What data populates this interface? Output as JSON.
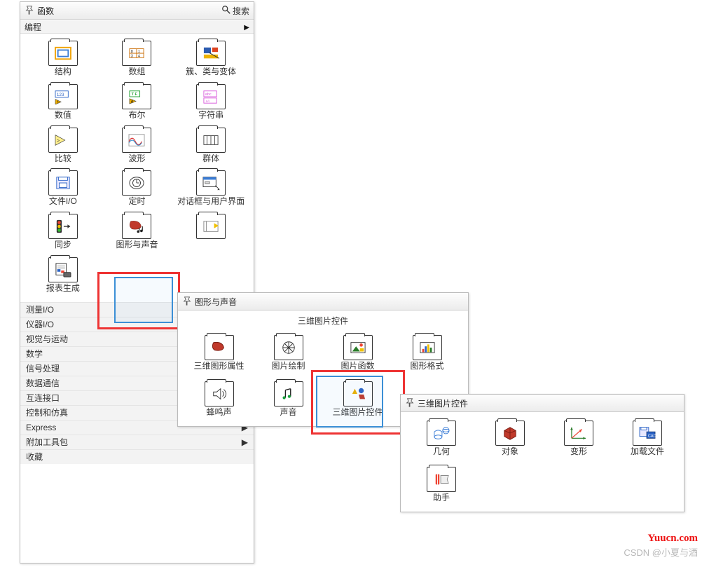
{
  "panel1": {
    "title": "函数",
    "search": "搜索",
    "category": "编程",
    "items": [
      {
        "label": "结构"
      },
      {
        "label": "数组"
      },
      {
        "label": "簇、类与变体"
      },
      {
        "label": "数值"
      },
      {
        "label": "布尔"
      },
      {
        "label": "字符串"
      },
      {
        "label": "比较"
      },
      {
        "label": "波形"
      },
      {
        "label": "群体"
      },
      {
        "label": "文件I/O"
      },
      {
        "label": "定时"
      },
      {
        "label": "对话框与用户界面"
      },
      {
        "label": "同步"
      },
      {
        "label": "图形与声音"
      },
      {
        "label": ""
      },
      {
        "label": "报表生成"
      }
    ],
    "list": [
      "测量I/O",
      "仪器I/O",
      "视觉与运动",
      "数学",
      "信号处理",
      "数据通信",
      "互连接口",
      "控制和仿真",
      "Express",
      "附加工具包",
      "收藏"
    ]
  },
  "panel2": {
    "title": "图形与声音",
    "subtitle": "三维图片控件",
    "items": [
      {
        "label": "三维图形属性"
      },
      {
        "label": "图片绘制"
      },
      {
        "label": "图片函数"
      },
      {
        "label": "图形格式"
      },
      {
        "label": "蜂鸣声"
      },
      {
        "label": "声音"
      },
      {
        "label": "三维图片控件"
      }
    ]
  },
  "panel3": {
    "title": "三维图片控件",
    "items": [
      {
        "label": "几何"
      },
      {
        "label": "对象"
      },
      {
        "label": "变形"
      },
      {
        "label": "加载文件"
      },
      {
        "label": "助手"
      }
    ]
  },
  "watermark1": "Yuucn.com",
  "watermark2": "CSDN @小夏与酒"
}
